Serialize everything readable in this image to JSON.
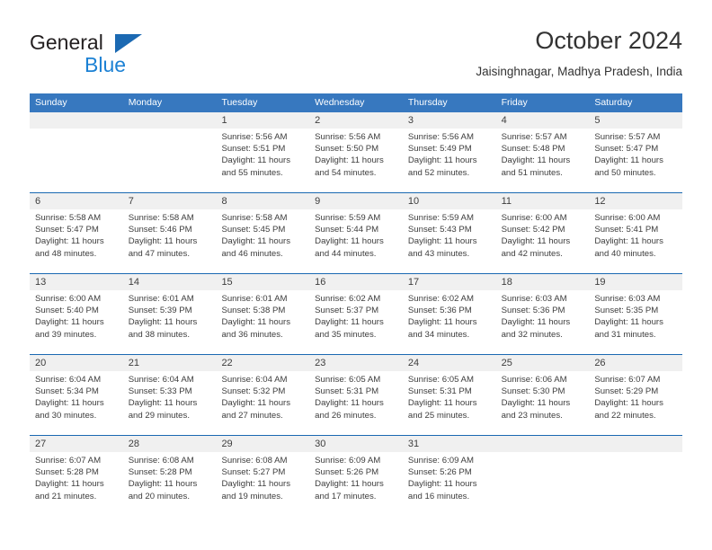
{
  "logo": {
    "word_one": "General",
    "word_two": "Blue",
    "triangle_color": "#1b69b2",
    "word_two_color": "#1c81d4"
  },
  "header": {
    "title": "October 2024",
    "subtitle": "Jaisinghnagar, Madhya Pradesh, India"
  },
  "theme": {
    "header_blue": "#3778bf",
    "rule_blue": "#1b69b2",
    "daynum_band": "#f0f0f0",
    "text": "#3d3d3d"
  },
  "calendar": {
    "weekdays": [
      "Sunday",
      "Monday",
      "Tuesday",
      "Wednesday",
      "Thursday",
      "Friday",
      "Saturday"
    ],
    "weeks": [
      [
        {
          "day": "",
          "lines": []
        },
        {
          "day": "",
          "lines": []
        },
        {
          "day": "1",
          "lines": [
            "Sunrise: 5:56 AM",
            "Sunset: 5:51 PM",
            "Daylight: 11 hours",
            "and 55 minutes."
          ]
        },
        {
          "day": "2",
          "lines": [
            "Sunrise: 5:56 AM",
            "Sunset: 5:50 PM",
            "Daylight: 11 hours",
            "and 54 minutes."
          ]
        },
        {
          "day": "3",
          "lines": [
            "Sunrise: 5:56 AM",
            "Sunset: 5:49 PM",
            "Daylight: 11 hours",
            "and 52 minutes."
          ]
        },
        {
          "day": "4",
          "lines": [
            "Sunrise: 5:57 AM",
            "Sunset: 5:48 PM",
            "Daylight: 11 hours",
            "and 51 minutes."
          ]
        },
        {
          "day": "5",
          "lines": [
            "Sunrise: 5:57 AM",
            "Sunset: 5:47 PM",
            "Daylight: 11 hours",
            "and 50 minutes."
          ]
        }
      ],
      [
        {
          "day": "6",
          "lines": [
            "Sunrise: 5:58 AM",
            "Sunset: 5:47 PM",
            "Daylight: 11 hours",
            "and 48 minutes."
          ]
        },
        {
          "day": "7",
          "lines": [
            "Sunrise: 5:58 AM",
            "Sunset: 5:46 PM",
            "Daylight: 11 hours",
            "and 47 minutes."
          ]
        },
        {
          "day": "8",
          "lines": [
            "Sunrise: 5:58 AM",
            "Sunset: 5:45 PM",
            "Daylight: 11 hours",
            "and 46 minutes."
          ]
        },
        {
          "day": "9",
          "lines": [
            "Sunrise: 5:59 AM",
            "Sunset: 5:44 PM",
            "Daylight: 11 hours",
            "and 44 minutes."
          ]
        },
        {
          "day": "10",
          "lines": [
            "Sunrise: 5:59 AM",
            "Sunset: 5:43 PM",
            "Daylight: 11 hours",
            "and 43 minutes."
          ]
        },
        {
          "day": "11",
          "lines": [
            "Sunrise: 6:00 AM",
            "Sunset: 5:42 PM",
            "Daylight: 11 hours",
            "and 42 minutes."
          ]
        },
        {
          "day": "12",
          "lines": [
            "Sunrise: 6:00 AM",
            "Sunset: 5:41 PM",
            "Daylight: 11 hours",
            "and 40 minutes."
          ]
        }
      ],
      [
        {
          "day": "13",
          "lines": [
            "Sunrise: 6:00 AM",
            "Sunset: 5:40 PM",
            "Daylight: 11 hours",
            "and 39 minutes."
          ]
        },
        {
          "day": "14",
          "lines": [
            "Sunrise: 6:01 AM",
            "Sunset: 5:39 PM",
            "Daylight: 11 hours",
            "and 38 minutes."
          ]
        },
        {
          "day": "15",
          "lines": [
            "Sunrise: 6:01 AM",
            "Sunset: 5:38 PM",
            "Daylight: 11 hours",
            "and 36 minutes."
          ]
        },
        {
          "day": "16",
          "lines": [
            "Sunrise: 6:02 AM",
            "Sunset: 5:37 PM",
            "Daylight: 11 hours",
            "and 35 minutes."
          ]
        },
        {
          "day": "17",
          "lines": [
            "Sunrise: 6:02 AM",
            "Sunset: 5:36 PM",
            "Daylight: 11 hours",
            "and 34 minutes."
          ]
        },
        {
          "day": "18",
          "lines": [
            "Sunrise: 6:03 AM",
            "Sunset: 5:36 PM",
            "Daylight: 11 hours",
            "and 32 minutes."
          ]
        },
        {
          "day": "19",
          "lines": [
            "Sunrise: 6:03 AM",
            "Sunset: 5:35 PM",
            "Daylight: 11 hours",
            "and 31 minutes."
          ]
        }
      ],
      [
        {
          "day": "20",
          "lines": [
            "Sunrise: 6:04 AM",
            "Sunset: 5:34 PM",
            "Daylight: 11 hours",
            "and 30 minutes."
          ]
        },
        {
          "day": "21",
          "lines": [
            "Sunrise: 6:04 AM",
            "Sunset: 5:33 PM",
            "Daylight: 11 hours",
            "and 29 minutes."
          ]
        },
        {
          "day": "22",
          "lines": [
            "Sunrise: 6:04 AM",
            "Sunset: 5:32 PM",
            "Daylight: 11 hours",
            "and 27 minutes."
          ]
        },
        {
          "day": "23",
          "lines": [
            "Sunrise: 6:05 AM",
            "Sunset: 5:31 PM",
            "Daylight: 11 hours",
            "and 26 minutes."
          ]
        },
        {
          "day": "24",
          "lines": [
            "Sunrise: 6:05 AM",
            "Sunset: 5:31 PM",
            "Daylight: 11 hours",
            "and 25 minutes."
          ]
        },
        {
          "day": "25",
          "lines": [
            "Sunrise: 6:06 AM",
            "Sunset: 5:30 PM",
            "Daylight: 11 hours",
            "and 23 minutes."
          ]
        },
        {
          "day": "26",
          "lines": [
            "Sunrise: 6:07 AM",
            "Sunset: 5:29 PM",
            "Daylight: 11 hours",
            "and 22 minutes."
          ]
        }
      ],
      [
        {
          "day": "27",
          "lines": [
            "Sunrise: 6:07 AM",
            "Sunset: 5:28 PM",
            "Daylight: 11 hours",
            "and 21 minutes."
          ]
        },
        {
          "day": "28",
          "lines": [
            "Sunrise: 6:08 AM",
            "Sunset: 5:28 PM",
            "Daylight: 11 hours",
            "and 20 minutes."
          ]
        },
        {
          "day": "29",
          "lines": [
            "Sunrise: 6:08 AM",
            "Sunset: 5:27 PM",
            "Daylight: 11 hours",
            "and 19 minutes."
          ]
        },
        {
          "day": "30",
          "lines": [
            "Sunrise: 6:09 AM",
            "Sunset: 5:26 PM",
            "Daylight: 11 hours",
            "and 17 minutes."
          ]
        },
        {
          "day": "31",
          "lines": [
            "Sunrise: 6:09 AM",
            "Sunset: 5:26 PM",
            "Daylight: 11 hours",
            "and 16 minutes."
          ]
        },
        {
          "day": "",
          "lines": []
        },
        {
          "day": "",
          "lines": []
        }
      ]
    ]
  }
}
